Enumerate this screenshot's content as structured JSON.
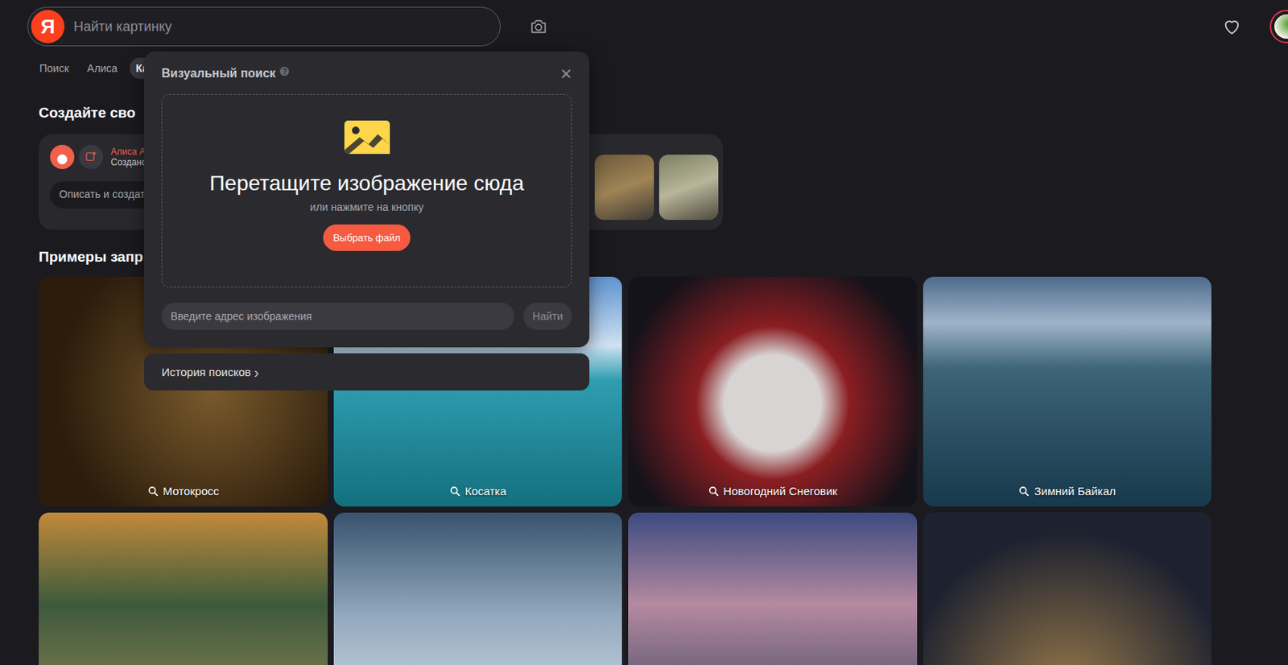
{
  "search": {
    "logo": "Я",
    "placeholder": "Найти картинку"
  },
  "nav": [
    {
      "label": "Поиск",
      "selected": false
    },
    {
      "label": "Алиса",
      "selected": false
    },
    {
      "label": "Ка",
      "selected": true
    }
  ],
  "create": {
    "title": "Создайте сво",
    "author": "Алиса А",
    "subtitle": "Создано",
    "input_placeholder": "Описать и создат"
  },
  "examples": {
    "title": "Примеры запр",
    "cards": [
      {
        "caption": "Мотокросс"
      },
      {
        "caption": "Косатка"
      },
      {
        "caption": "Новогодний Снеговик"
      },
      {
        "caption": "Зимний Байкал"
      },
      {},
      {},
      {},
      {}
    ]
  },
  "popup": {
    "title": "Визуальный поиск",
    "help": "?",
    "close": "×",
    "drop_title": "Перетащите изображение сюда",
    "drop_hint": "или нажмите на кнопку",
    "choose_button": "Выбрать файл",
    "url_placeholder": "Введите адрес изображения",
    "find_button": "Найти",
    "history": "История поисков",
    "history_arrow": "›"
  }
}
